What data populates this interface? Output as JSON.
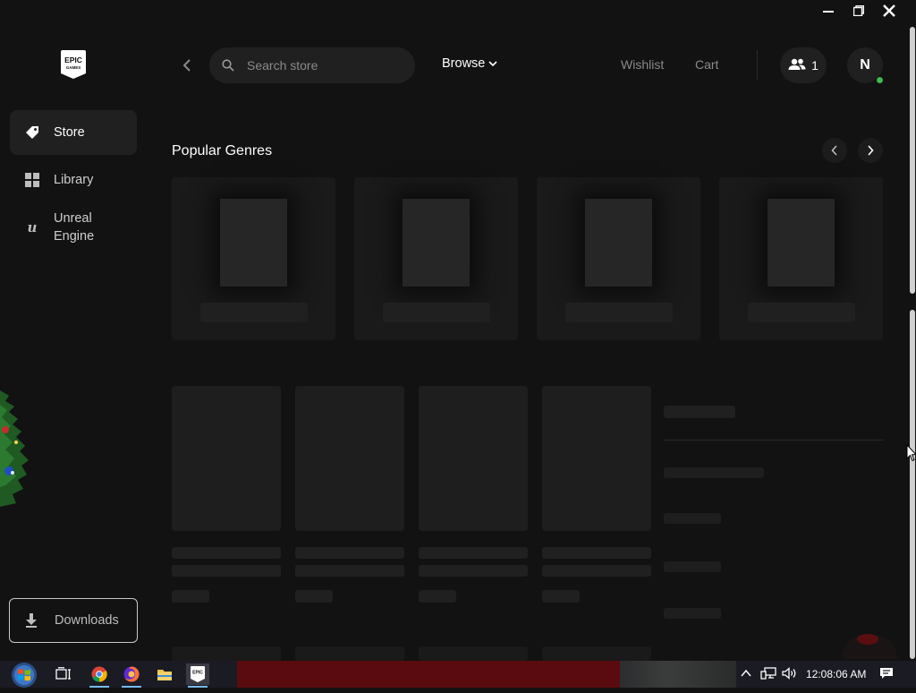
{
  "window": {
    "controls": [
      "minimize-icon",
      "restore-icon",
      "close-icon"
    ]
  },
  "sidebar": {
    "logo_text": "EPIC GAMES",
    "items": [
      {
        "label": "Store",
        "icon": "tag-icon",
        "active": true
      },
      {
        "label": "Library",
        "icon": "grid-icon",
        "active": false
      },
      {
        "label": "Unreal Engine",
        "icon": "unreal-icon",
        "active": false
      }
    ],
    "downloads_label": "Downloads"
  },
  "topbar": {
    "search_placeholder": "Search store",
    "browse_label": "Browse",
    "wishlist_label": "Wishlist",
    "cart_label": "Cart",
    "friends_count": "1",
    "avatar_initial": "N",
    "online_color": "#3fb950"
  },
  "content": {
    "section_title": "Popular Genres"
  },
  "taskbar": {
    "clock": "12:08:06 AM"
  },
  "colors": {
    "background": "#121212",
    "surface": "#202020",
    "placeholder": "#1e1e1e"
  }
}
